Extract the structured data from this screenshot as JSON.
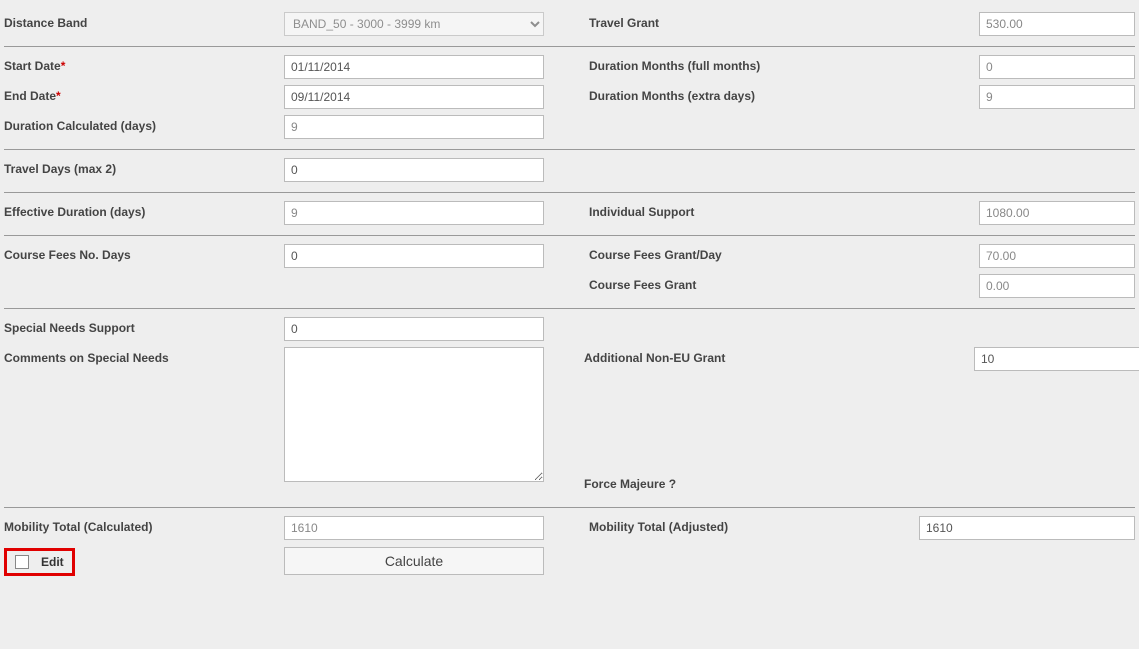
{
  "labels": {
    "distance_band": "Distance Band",
    "travel_grant": "Travel Grant",
    "start_date": "Start Date",
    "end_date": "End Date",
    "duration_calculated": "Duration Calculated (days)",
    "duration_months_full": "Duration Months (full months)",
    "duration_months_extra": "Duration Months (extra days)",
    "travel_days": "Travel Days (max 2)",
    "effective_duration": "Effective Duration (days)",
    "individual_support": "Individual Support",
    "course_fees_nodays": "Course Fees No. Days",
    "course_fees_grant_day": "Course Fees Grant/Day",
    "course_fees_grant": "Course Fees Grant",
    "special_needs_support": "Special Needs Support",
    "comments_special_needs": "Comments on Special Needs",
    "additional_noneu_grant": "Additional Non-EU Grant",
    "force_majeure": "Force Majeure ?",
    "mobility_total_calc": "Mobility Total (Calculated)",
    "mobility_total_adj": "Mobility Total (Adjusted)",
    "edit": "Edit",
    "calculate": "Calculate"
  },
  "values": {
    "distance_band": "BAND_50 - 3000 - 3999 km",
    "travel_grant": "530.00",
    "start_date": "01/11/2014",
    "end_date": "09/11/2014",
    "duration_calculated": "9",
    "duration_months_full": "0",
    "duration_months_extra": "9",
    "travel_days": "0",
    "effective_duration": "9",
    "individual_support": "1080.00",
    "course_fees_nodays": "0",
    "course_fees_grant_day": "70.00",
    "course_fees_grant": "0.00",
    "special_needs_support": "0",
    "comments_special_needs": "",
    "additional_noneu_grant": "10",
    "mobility_total_calc": "1610",
    "mobility_total_adj": "1610"
  }
}
